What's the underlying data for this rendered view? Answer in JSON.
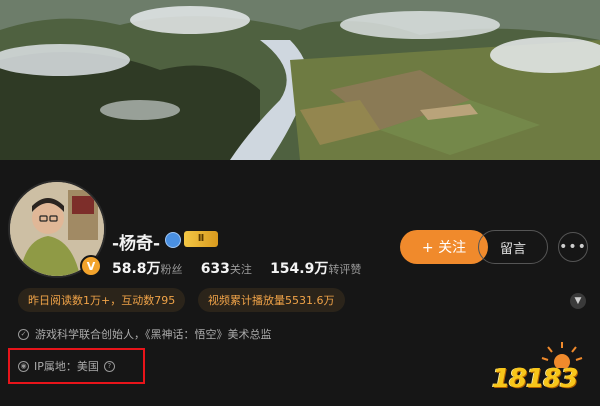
{
  "profile": {
    "name": "-杨奇-",
    "level_badge": "Ⅱ",
    "avatar_badge": "V",
    "stats": [
      {
        "value": "58.8万",
        "label": "粉丝"
      },
      {
        "value": "633",
        "label": "关注"
      },
      {
        "value": "154.9万",
        "label": "转评赞"
      }
    ],
    "follow_button": "+ 关注",
    "message_button": "留言",
    "more_button": "•••",
    "tags": [
      "昨日阅读数1万+，互动数795",
      "视频累计播放量5531.6万"
    ],
    "description": "游戏科学联合创始人，《黑神话：悟空》美术总监",
    "ip_location": "IP属地：美国",
    "help_symbol": "?"
  },
  "watermark": {
    "text": "18183"
  },
  "colors": {
    "accent_orange": "#f08a2c",
    "tag_text": "#f0a348",
    "highlight_box": "#e8141a"
  }
}
